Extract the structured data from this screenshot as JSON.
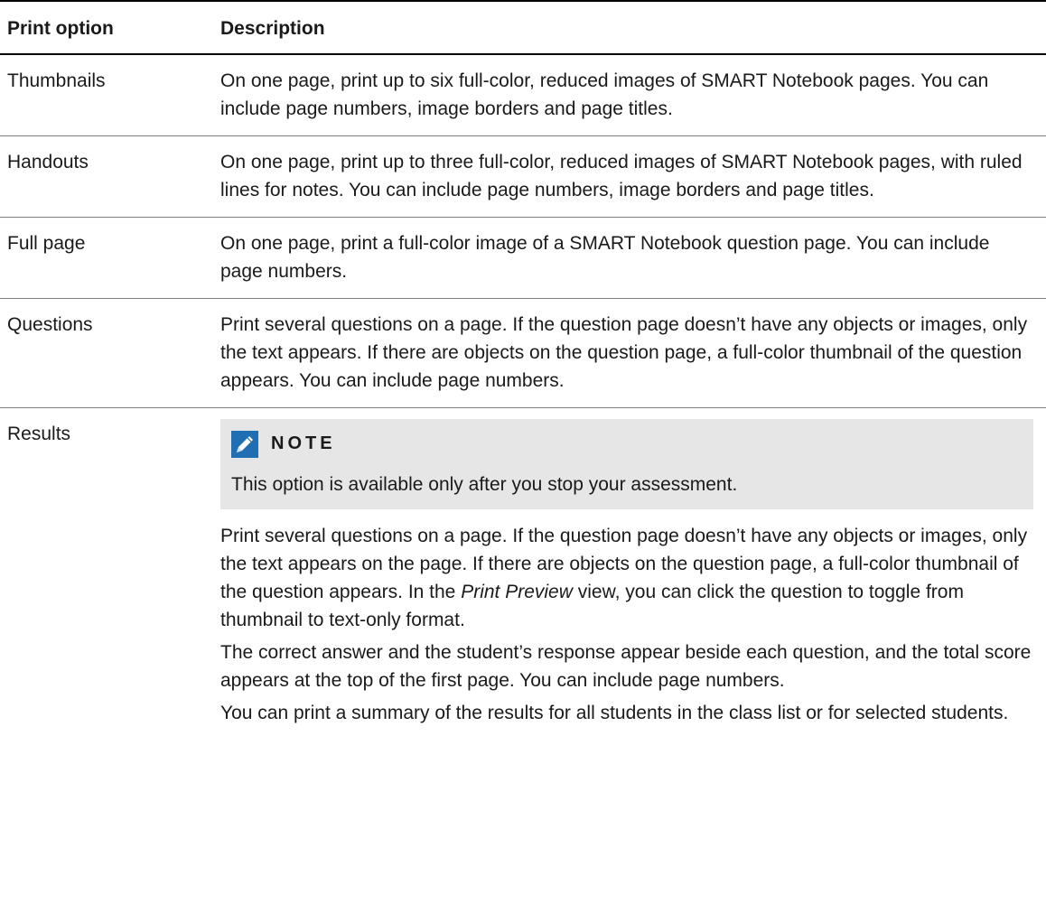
{
  "table": {
    "headers": [
      "Print option",
      "Description"
    ],
    "rows": [
      {
        "option": "Thumbnails",
        "description": "On one page, print up to six full-color, reduced images of SMART Notebook pages. You can include page numbers, image borders and page titles."
      },
      {
        "option": "Handouts",
        "description": "On one page, print up to three full-color, reduced images of SMART Notebook pages, with ruled lines for notes. You can include page numbers, image borders and page titles."
      },
      {
        "option": "Full page",
        "description": "On one page, print a full-color image of a SMART Notebook question page. You can include page numbers."
      },
      {
        "option": "Questions",
        "description": "Print several questions on a page. If the question page doesn’t have any objects or images, only the text appears. If there are objects on the question page, a full-color thumbnail of the question appears. You can include page numbers."
      }
    ],
    "results": {
      "option": "Results",
      "note": {
        "icon": "pencil-icon",
        "title": "NOTE",
        "text": "This option is available only after you stop your assessment."
      },
      "para1_before": "Print several questions on a page. If the question page doesn’t have any objects or images, only the text appears on the page. If there are objects on the question page, a full-color thumbnail of the question appears. In the ",
      "para1_italic": "Print Preview",
      "para1_after": " view, you can click the question to toggle from thumbnail to text-only format.",
      "para2": "The correct answer and the student’s response appear beside each question, and the total score appears at the top of the first page. You can include page numbers.",
      "para3": "You can print a summary of the results for all students in the class list or for selected students."
    }
  },
  "colors": {
    "note_background": "#e6e6e6",
    "icon_blue": "#1f6fb2"
  }
}
